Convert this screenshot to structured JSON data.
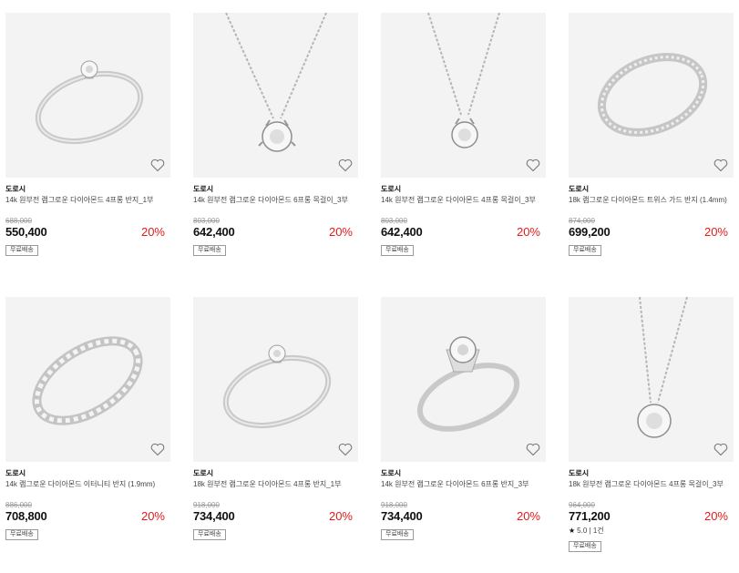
{
  "products": [
    {
      "brand": "도로시",
      "name": "14k 원부전 램그로운 다이아몬드 4프롱 반지_1부",
      "original_price": "688,000",
      "price": "550,400",
      "discount": "20%",
      "shipping": "무료배송",
      "image_icon": "solitaire-ring-icon"
    },
    {
      "brand": "도로시",
      "name": "14k 원부전 램그로운 다이아몬드 6프롱 목걸이_3부",
      "original_price": "803,000",
      "price": "642,400",
      "discount": "20%",
      "shipping": "무료배송",
      "image_icon": "solitaire-necklace-icon"
    },
    {
      "brand": "도로시",
      "name": "14k 원부전 램그로운 다이아몬드 4프롱 목걸이_3부",
      "original_price": "803,000",
      "price": "642,400",
      "discount": "20%",
      "shipping": "무료배송",
      "image_icon": "solitaire-necklace-icon"
    },
    {
      "brand": "도로시",
      "name": "18k 램그로운 다이아몬드 트위스 가드 반지 (1.4mm)",
      "original_price": "874,000",
      "price": "699,200",
      "discount": "20%",
      "shipping": "무료배송",
      "image_icon": "eternity-band-icon"
    },
    {
      "brand": "도로시",
      "name": "14k 램그로운 다이아몬드 이터니티 반지 (1.9mm)",
      "original_price": "886,000",
      "price": "708,800",
      "discount": "20%",
      "shipping": "무료배송",
      "image_icon": "eternity-ring-icon"
    },
    {
      "brand": "도로시",
      "name": "18k 원부전 램그로운 다이아몬드 4프롱 반지_1부",
      "original_price": "918,000",
      "price": "734,400",
      "discount": "20%",
      "shipping": "무료배송",
      "image_icon": "solitaire-ring-icon"
    },
    {
      "brand": "도로시",
      "name": "14k 원부전 램그로운 다이아몬드 6프롱 반지_3부",
      "original_price": "918,000",
      "price": "734,400",
      "discount": "20%",
      "shipping": "무료배송",
      "image_icon": "six-prong-ring-icon"
    },
    {
      "brand": "도로시",
      "name": "18k 원부전 램그로운 다이아몬드 4프롱 목걸이_3부",
      "original_price": "964,000",
      "price": "771,200",
      "discount": "20%",
      "rating": "5.0",
      "review_count": "1건",
      "shipping": "무료배송",
      "image_icon": "solitaire-necklace-icon"
    }
  ],
  "colors": {
    "discount": "#e41a1a",
    "thumb_bg": "#f3f3f3"
  },
  "heart_icon": "heart-icon"
}
